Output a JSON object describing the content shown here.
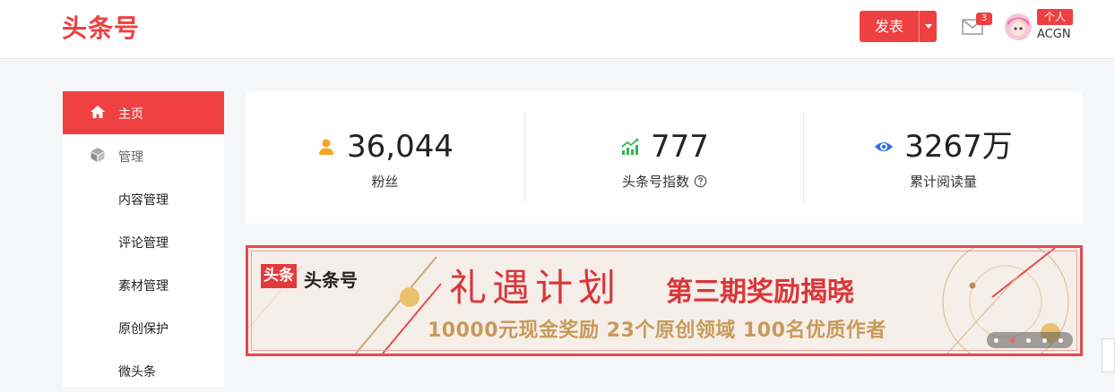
{
  "header": {
    "logo": "头条号",
    "publish_label": "发表",
    "mail_badge": "3",
    "account_tag": "个人",
    "username": "ACGN"
  },
  "sidebar": {
    "items": [
      {
        "label": "主页",
        "icon": "home-icon",
        "active": true
      },
      {
        "label": "管理",
        "icon": "cube-icon",
        "group": true
      },
      {
        "label": "内容管理"
      },
      {
        "label": "评论管理"
      },
      {
        "label": "素材管理"
      },
      {
        "label": "原创保护"
      },
      {
        "label": "微头条"
      }
    ]
  },
  "stats": [
    {
      "value": "36,044",
      "label": "粉丝",
      "icon": "user-icon",
      "color": "#f5a623"
    },
    {
      "value": "777",
      "label": "头条号指数",
      "icon": "trend-chart-icon",
      "color": "#2db84d",
      "help": true
    },
    {
      "value": "3267万",
      "label": "累计阅读量",
      "icon": "eye-icon",
      "color": "#2f6fe0"
    }
  ],
  "banner": {
    "logo_badge": "头条",
    "logo_text": "头条号",
    "title": "礼遇计划",
    "subtitle": "第三期奖励揭晓",
    "tagline": "10000元现金奖励  23个原创领域  100名优质作者"
  },
  "colors": {
    "brand": "#ef4040",
    "accent_gold": "#c79a5a"
  }
}
